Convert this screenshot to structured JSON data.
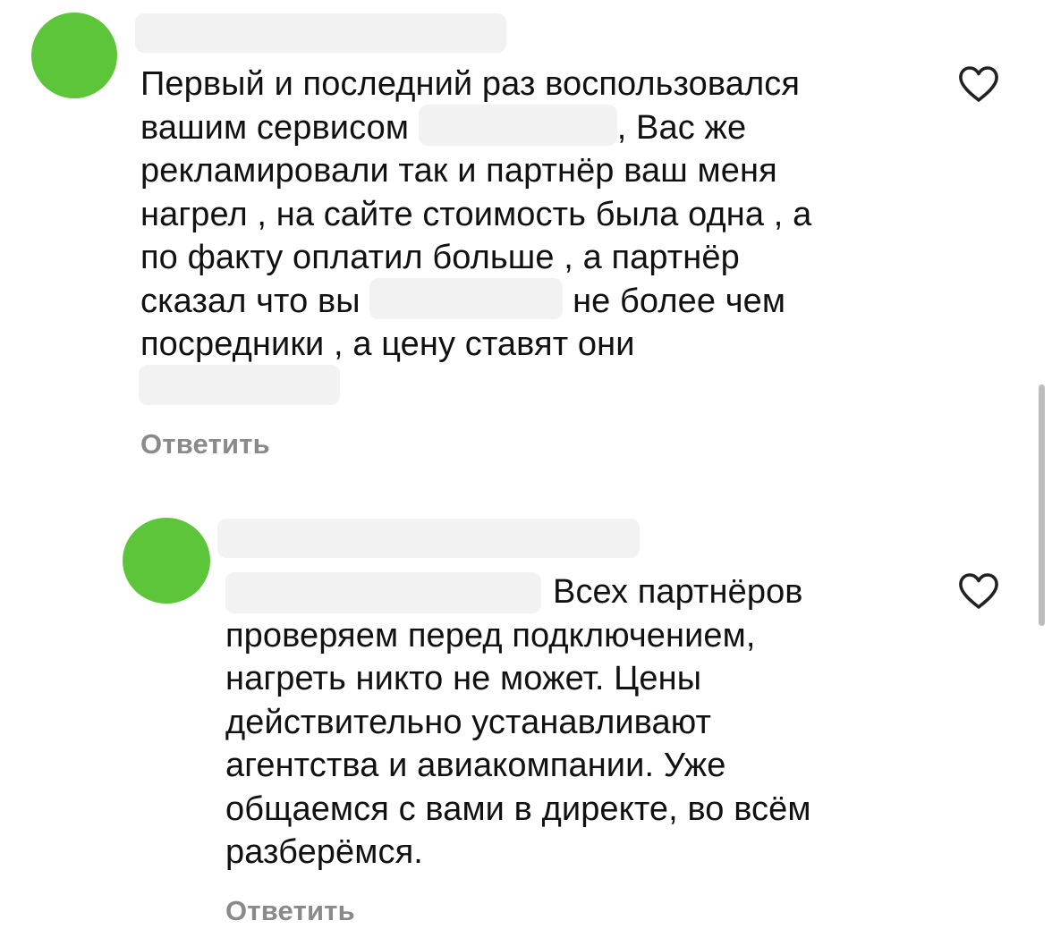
{
  "colors": {
    "avatar": "#5cc53a",
    "reply": "#8a8a8a",
    "redaction": "#f2f2f2"
  },
  "comments": [
    {
      "lines": [
        "Первый и последний раз воспользовался",
        "вашим сервисом",
        ", Вас же",
        "рекламировали так и партнёр ваш меня",
        "нагрел , на сайте стоимость была одна , а",
        "по факту оплатил больше , а партнёр",
        "сказал что вы",
        "не более чем",
        "посредники , а цену ставят они"
      ],
      "reply_label": "Ответить",
      "like_icon": "heart-outline-icon"
    },
    {
      "lines": [
        "Всех партнёров",
        "проверяем перед подключением,",
        "нагреть никто не может. Цены",
        "действительно устанавливают",
        "агентства и авиакомпании. Уже",
        "общаемся с вами в директе, во всём",
        "разберёмся."
      ],
      "reply_label": "Ответить",
      "like_icon": "heart-outline-icon"
    }
  ]
}
